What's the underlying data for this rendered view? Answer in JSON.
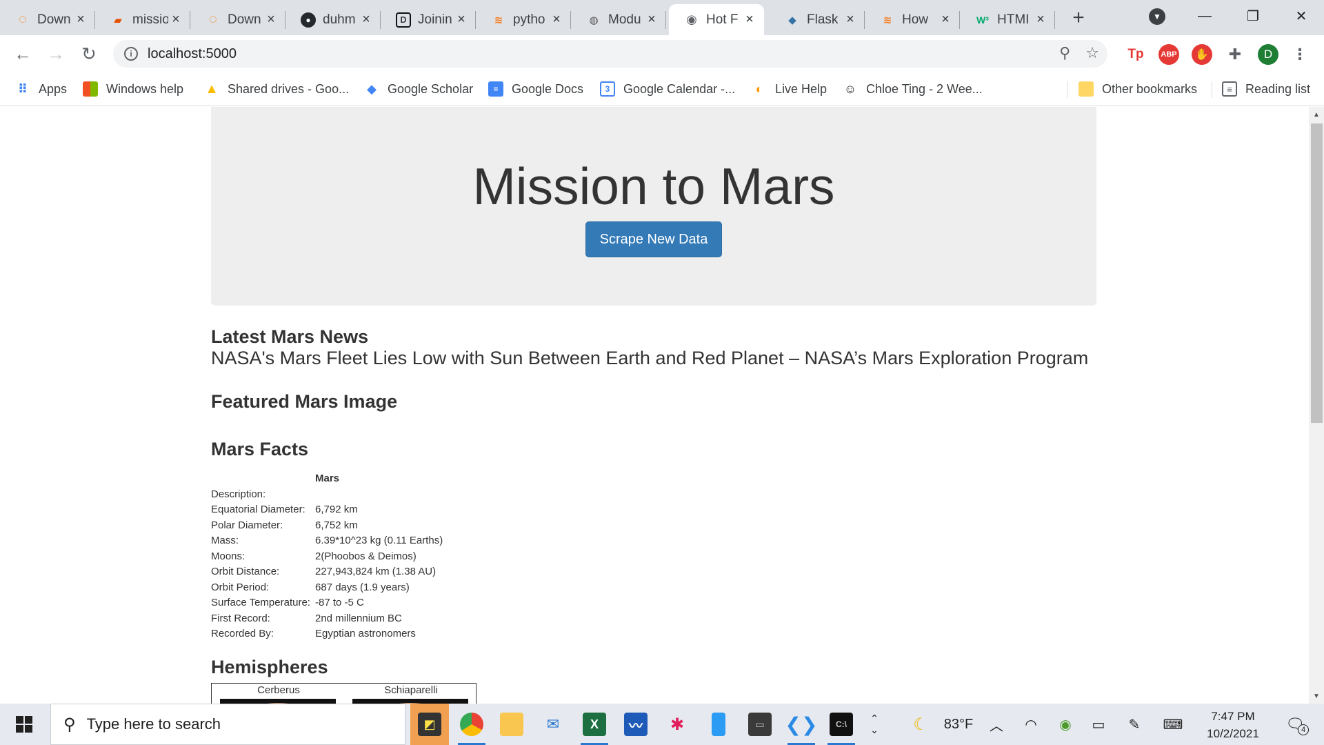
{
  "browser": {
    "tabs": [
      {
        "title": "Down",
        "icon": "loader-icon"
      },
      {
        "title": "missio",
        "icon": "book-icon"
      },
      {
        "title": "Down",
        "icon": "loader-icon"
      },
      {
        "title": "duhm",
        "icon": "github-icon"
      },
      {
        "title": "Joinin",
        "icon": "d-logo-icon"
      },
      {
        "title": "pytho",
        "icon": "stackoverflow-icon"
      },
      {
        "title": "Modu",
        "icon": "module-icon"
      },
      {
        "title": "Hot F",
        "icon": "globe-icon"
      },
      {
        "title": "Flask",
        "icon": "python-icon"
      },
      {
        "title": "How",
        "icon": "stackoverflow-icon"
      },
      {
        "title": "HTMI",
        "icon": "w3-icon"
      }
    ],
    "active_tab_index": 7,
    "url": "localhost:5000",
    "profile_initial": "D",
    "extensions": [
      "Tp",
      "ABP"
    ],
    "bookmarks": [
      {
        "label": "Apps",
        "icon": "apps-grid-icon"
      },
      {
        "label": "Windows help",
        "icon": "windows-icon"
      },
      {
        "label": "Shared drives - Goo...",
        "icon": "google-drive-icon"
      },
      {
        "label": "Google Scholar",
        "icon": "scholar-icon"
      },
      {
        "label": "Google Docs",
        "icon": "docs-icon"
      },
      {
        "label": "Google Calendar -...",
        "icon": "calendar-icon"
      },
      {
        "label": "Live Help",
        "icon": "live-help-icon"
      },
      {
        "label": "Chloe Ting - 2 Wee...",
        "icon": "chloe-icon"
      },
      {
        "label": "Other bookmarks",
        "icon": "folder-icon"
      },
      {
        "label": "Reading list",
        "icon": "reading-list-icon"
      }
    ],
    "calendar_icon_number": "3"
  },
  "page": {
    "title": "Mission to Mars",
    "scrape_button": "Scrape New Data",
    "news_heading": "Latest Mars News",
    "news_title": "NASA's Mars Fleet Lies Low with Sun Between Earth and Red Planet – NASA’s Mars Exploration Program",
    "image_heading": "Featured Mars Image",
    "facts_heading": "Mars Facts",
    "facts_column": "Mars",
    "facts": [
      {
        "label": "Description:",
        "value": ""
      },
      {
        "label": "Equatorial Diameter:",
        "value": "6,792 km"
      },
      {
        "label": "Polar Diameter:",
        "value": "6,752 km"
      },
      {
        "label": "Mass:",
        "value": "6.39*10^23 kg (0.11 Earths)"
      },
      {
        "label": "Moons:",
        "value": "2(Phoobos & Deimos)"
      },
      {
        "label": "Orbit Distance:",
        "value": "227,943,824 km (1.38 AU)"
      },
      {
        "label": "Orbit Period:",
        "value": "687 days (1.9 years)"
      },
      {
        "label": "Surface Temperature:",
        "value": "-87 to -5 C"
      },
      {
        "label": "First Record:",
        "value": "2nd millennium BC"
      },
      {
        "label": "Recorded By:",
        "value": "Egyptian astronomers"
      }
    ],
    "hemispheres_heading": "Hemispheres",
    "hemispheres": [
      "Cerberus",
      "Schiaparelli"
    ]
  },
  "taskbar": {
    "search_placeholder": "Type here to search",
    "weather": "83°F",
    "time": "7:47 PM",
    "date": "10/2/2021",
    "notifications": "4"
  },
  "colors": {
    "primary_button": "#337ab7",
    "jumbotron_bg": "#eeeeee",
    "tab_strip_bg": "#dee1e6"
  }
}
